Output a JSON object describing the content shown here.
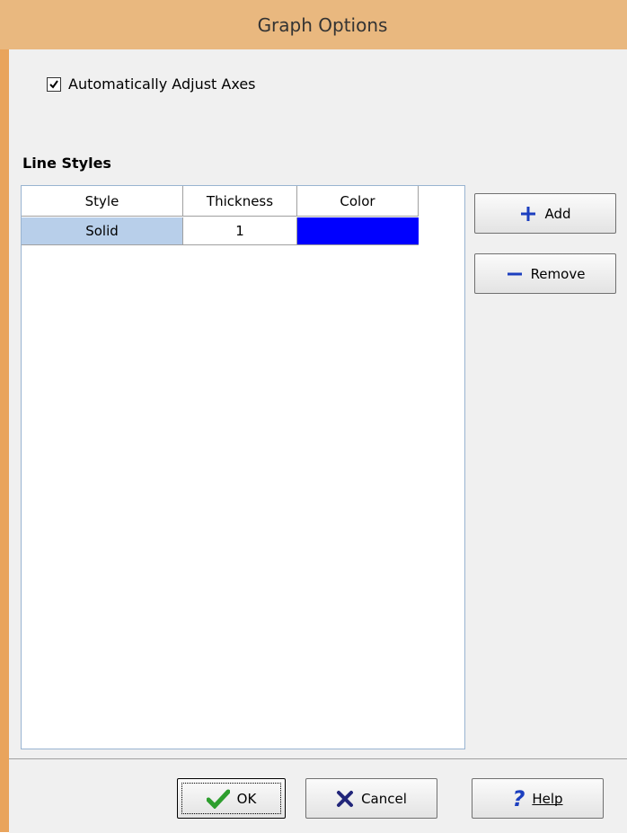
{
  "window": {
    "title": "Graph Options"
  },
  "options": {
    "auto_adjust_label": "Automatically Adjust Axes",
    "auto_adjust_checked": true
  },
  "line_styles": {
    "group_label": "Line Styles",
    "columns": [
      "Style",
      "Thickness",
      "Color"
    ],
    "rows": [
      {
        "style": "Solid",
        "thickness": "1",
        "color": "#0000ff"
      }
    ]
  },
  "buttons": {
    "add": "Add",
    "remove": "Remove",
    "ok": "OK",
    "cancel": "Cancel",
    "help": "Help"
  },
  "colors": {
    "frame": "#e9a45c",
    "title_bg": "#e9b87f",
    "selection": "#b8cfea"
  }
}
